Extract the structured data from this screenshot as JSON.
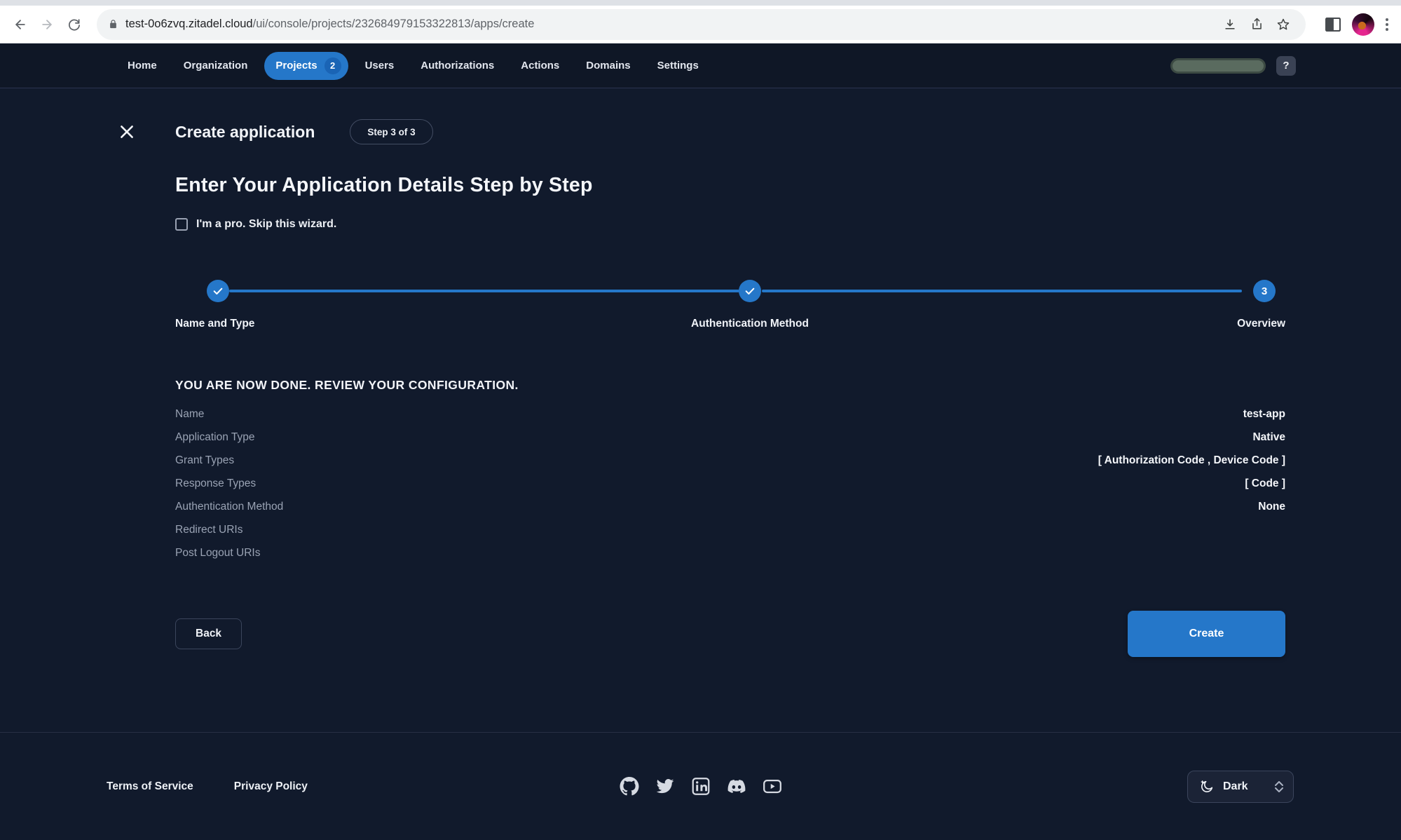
{
  "browser": {
    "url_domain": "test-0o6zvq.zitadel.cloud",
    "url_path": "/ui/console/projects/232684979153322813/apps/create"
  },
  "nav": {
    "items": [
      "Home",
      "Organization",
      "Projects",
      "Users",
      "Authorizations",
      "Actions",
      "Domains",
      "Settings"
    ],
    "projects_badge": "2",
    "help_label": "?"
  },
  "wizard": {
    "title": "Create application",
    "step_badge": "Step 3 of 3",
    "heading": "Enter Your Application Details Step by Step",
    "skip_label": "I'm a pro. Skip this wizard.",
    "steps": [
      {
        "label": "Name and Type",
        "state": "done"
      },
      {
        "label": "Authentication Method",
        "state": "done"
      },
      {
        "label": "Overview",
        "state": "current",
        "number": "3"
      }
    ],
    "review": {
      "title": "YOU ARE NOW DONE. REVIEW YOUR CONFIGURATION.",
      "rows": [
        {
          "label": "Name",
          "value": "test-app"
        },
        {
          "label": "Application Type",
          "value": "Native"
        },
        {
          "label": "Grant Types",
          "value": "[ Authorization Code , Device Code ]"
        },
        {
          "label": "Response Types",
          "value": "[ Code ]"
        },
        {
          "label": "Authentication Method",
          "value": "None"
        },
        {
          "label": "Redirect URIs",
          "value": ""
        },
        {
          "label": "Post Logout URIs",
          "value": ""
        }
      ]
    },
    "back_label": "Back",
    "create_label": "Create"
  },
  "footer": {
    "links": [
      "Terms of Service",
      "Privacy Policy"
    ],
    "social_icons": [
      "github",
      "twitter",
      "linkedin",
      "discord",
      "youtube"
    ],
    "theme_label": "Dark"
  },
  "colors": {
    "accent_blue": "#2577c9",
    "badge_blue": "#1a64b5",
    "background": "#111a2c",
    "nav_background": "#0f1726"
  }
}
